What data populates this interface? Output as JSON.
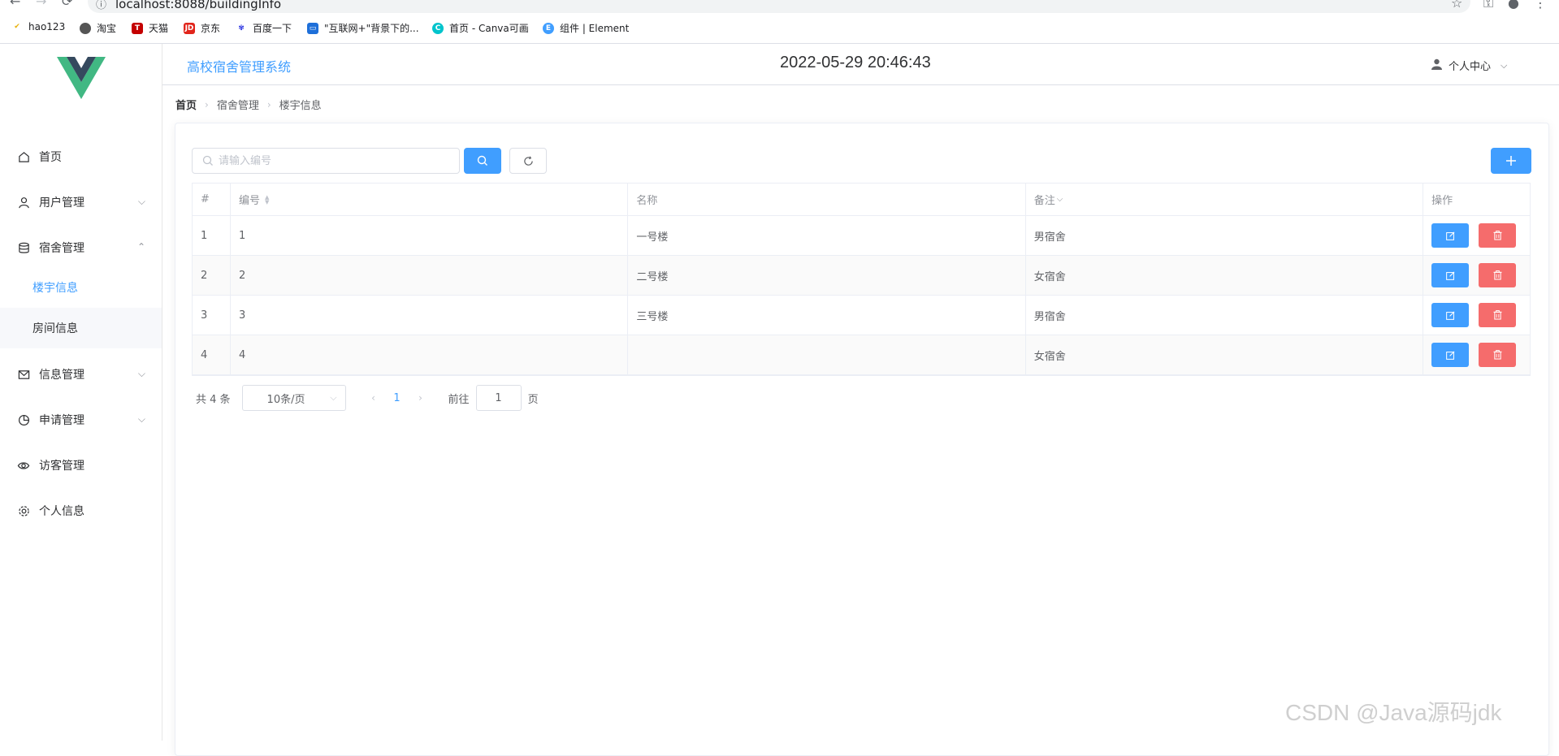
{
  "browser": {
    "url": "localhost:8088/buildingInfo",
    "bookmarks": [
      "hao123",
      "淘宝",
      "天猫",
      "京东",
      "百度一下",
      "\"互联网+\"背景下的...",
      "首页 - Canva可画",
      "组件 | Element"
    ]
  },
  "header": {
    "title": "高校宿舍管理系统",
    "clock": "2022-05-29 20:46:43",
    "user_menu": "个人中心"
  },
  "sidebar": {
    "items": [
      {
        "label": "首页",
        "icon": "home-icon"
      },
      {
        "label": "用户管理",
        "icon": "user-icon"
      },
      {
        "label": "宿舍管理",
        "icon": "database-icon"
      },
      {
        "label": "信息管理",
        "icon": "message-icon"
      },
      {
        "label": "申请管理",
        "icon": "pie-chart-icon"
      },
      {
        "label": "访客管理",
        "icon": "eye-icon"
      },
      {
        "label": "个人信息",
        "icon": "setting-icon"
      }
    ],
    "sub_items": [
      {
        "label": "楼宇信息"
      },
      {
        "label": "房间信息"
      }
    ]
  },
  "breadcrumb": [
    "首页",
    "宿舍管理",
    "楼宇信息"
  ],
  "toolbar": {
    "search_placeholder": "请输入编号",
    "search_value": ""
  },
  "table": {
    "headers": [
      "#",
      "编号",
      "名称",
      "备注",
      "操作"
    ],
    "rows": [
      {
        "index": "1",
        "id": "1",
        "name": "一号楼",
        "remark": "男宿舍"
      },
      {
        "index": "2",
        "id": "2",
        "name": "二号楼",
        "remark": "女宿舍"
      },
      {
        "index": "3",
        "id": "3",
        "name": "三号楼",
        "remark": "男宿舍"
      },
      {
        "index": "4",
        "id": "4",
        "name": "",
        "remark": "女宿舍"
      }
    ]
  },
  "pagination": {
    "total": "共 4 条",
    "page_size": "10条/页",
    "current_page": "1",
    "goto_label": "前往",
    "goto_value": "1",
    "page_suffix": "页"
  },
  "watermark": "CSDN @Java源码jdk",
  "colors": {
    "primary": "#409eff",
    "danger": "#f56c6c",
    "logo_green": "#41b883",
    "logo_dark": "#35495e"
  }
}
